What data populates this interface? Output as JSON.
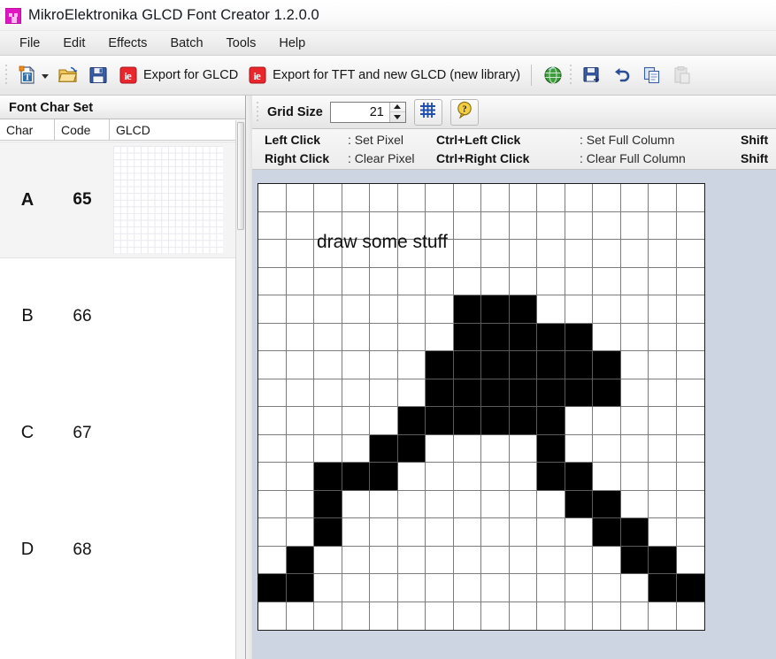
{
  "window": {
    "title": "MikroElektronika GLCD Font Creator 1.2.0.0",
    "icon": "app-icon"
  },
  "menubar": {
    "items": [
      {
        "label": "File"
      },
      {
        "label": "Edit"
      },
      {
        "label": "Effects"
      },
      {
        "label": "Batch"
      },
      {
        "label": "Tools"
      },
      {
        "label": "Help"
      }
    ]
  },
  "toolbar": {
    "new_label": "",
    "open_label": "",
    "save_label": "",
    "export_glcd_label": "Export for GLCD",
    "export_tft_label": "Export for TFT and new GLCD (new library)",
    "globe_label": "",
    "save_as_label": "",
    "undo_label": "",
    "copy_label": "",
    "paste_label": "",
    "icons": [
      "new-font-icon",
      "open-folder-icon",
      "save-icon",
      "export-glcd-icon",
      "export-tft-icon",
      "globe-icon",
      "save-as-icon",
      "undo-icon",
      "copy-icon",
      "paste-icon"
    ]
  },
  "left_panel": {
    "header": "Font Char Set",
    "columns": [
      "Char",
      "Code",
      "GLCD"
    ],
    "rows": [
      {
        "char": "A",
        "code": "65",
        "selected": true
      },
      {
        "char": "B",
        "code": "66",
        "selected": false
      },
      {
        "char": "C",
        "code": "67",
        "selected": false
      },
      {
        "char": "D",
        "code": "68",
        "selected": false
      }
    ]
  },
  "grid_toolbar": {
    "grid_size_label": "Grid Size",
    "grid_size_value": "21",
    "toggle_grid_icon": "grid-toggle-icon",
    "help_icon": "help-question-icon"
  },
  "legend": {
    "rows": [
      {
        "key1": "Left Click",
        "val1": ": Set Pixel",
        "key2": "Ctrl+Left Click",
        "val2": ": Set Full Column",
        "key3": "Shift"
      },
      {
        "key1": "Right Click",
        "val1": ": Clear Pixel",
        "key2": "Ctrl+Right Click",
        "val2": ": Clear Full Column",
        "key3": "Shift"
      }
    ]
  },
  "canvas": {
    "note": "draw some stuff",
    "cols": 16,
    "rows": 16,
    "on_color": "#000000",
    "off_color": "#ffffff",
    "grid_line_color": "#7d7d7d",
    "pixels": [
      [
        0,
        0,
        0,
        0,
        0,
        0,
        0,
        0,
        0,
        0,
        0,
        0,
        0,
        0,
        0,
        0
      ],
      [
        0,
        0,
        0,
        0,
        0,
        0,
        0,
        0,
        0,
        0,
        0,
        0,
        0,
        0,
        0,
        0
      ],
      [
        0,
        0,
        0,
        0,
        0,
        0,
        0,
        0,
        0,
        0,
        0,
        0,
        0,
        0,
        0,
        0
      ],
      [
        0,
        0,
        0,
        0,
        0,
        0,
        0,
        0,
        0,
        0,
        0,
        0,
        0,
        0,
        0,
        0
      ],
      [
        0,
        0,
        0,
        0,
        0,
        0,
        0,
        1,
        1,
        1,
        0,
        0,
        0,
        0,
        0,
        0
      ],
      [
        0,
        0,
        0,
        0,
        0,
        0,
        0,
        1,
        1,
        1,
        1,
        1,
        0,
        0,
        0,
        0
      ],
      [
        0,
        0,
        0,
        0,
        0,
        0,
        1,
        1,
        1,
        1,
        1,
        1,
        1,
        0,
        0,
        0
      ],
      [
        0,
        0,
        0,
        0,
        0,
        0,
        1,
        1,
        1,
        1,
        1,
        1,
        1,
        0,
        0,
        0
      ],
      [
        0,
        0,
        0,
        0,
        0,
        1,
        1,
        1,
        1,
        1,
        1,
        0,
        0,
        0,
        0,
        0
      ],
      [
        0,
        0,
        0,
        0,
        1,
        1,
        0,
        0,
        0,
        0,
        1,
        0,
        0,
        0,
        0,
        0
      ],
      [
        0,
        0,
        1,
        1,
        1,
        0,
        0,
        0,
        0,
        0,
        1,
        1,
        0,
        0,
        0,
        0
      ],
      [
        0,
        0,
        1,
        0,
        0,
        0,
        0,
        0,
        0,
        0,
        0,
        1,
        1,
        0,
        0,
        0
      ],
      [
        0,
        0,
        1,
        0,
        0,
        0,
        0,
        0,
        0,
        0,
        0,
        0,
        1,
        1,
        0,
        0
      ],
      [
        0,
        1,
        0,
        0,
        0,
        0,
        0,
        0,
        0,
        0,
        0,
        0,
        0,
        1,
        1,
        0
      ],
      [
        1,
        1,
        0,
        0,
        0,
        0,
        0,
        0,
        0,
        0,
        0,
        0,
        0,
        0,
        1,
        1
      ]
    ]
  },
  "colors": {
    "panel_bg": "#ccd5e1",
    "accent_red": "#e8262c",
    "accent_magenta": "#e016c4",
    "toolbar_bg": "#f1f1f1"
  }
}
